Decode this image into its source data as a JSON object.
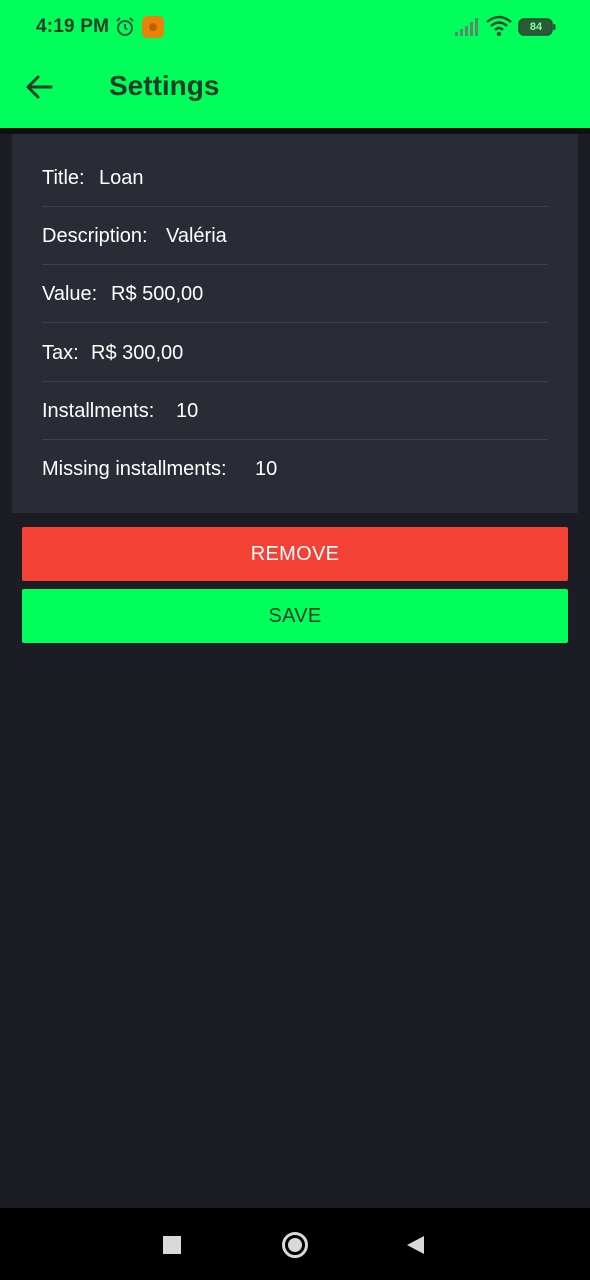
{
  "status_bar": {
    "time": "4:19 PM",
    "battery": "84",
    "icons": [
      "alarm-icon",
      "notification-app-icon",
      "signal-icon",
      "wifi-icon",
      "battery-icon"
    ]
  },
  "app_bar": {
    "title": "Settings",
    "back_icon": "arrow-left-icon"
  },
  "fields": [
    {
      "label": "Title:",
      "value": "Loan"
    },
    {
      "label": "Description:",
      "value": "Valéria"
    },
    {
      "label": "Value:",
      "value": "R$ 500,00"
    },
    {
      "label": "Tax:",
      "value": "R$ 300,00"
    },
    {
      "label": "Installments:",
      "value": "10"
    },
    {
      "label": "Missing installments:",
      "value": "10"
    }
  ],
  "actions": {
    "remove_label": "REMOVE",
    "save_label": "SAVE"
  },
  "nav_bar": {
    "icons": [
      "recents-square-icon",
      "home-circle-icon",
      "back-triangle-icon"
    ]
  },
  "colors": {
    "accent_green": "#00ff5a",
    "remove_red": "#f34235",
    "background": "#1b1c24",
    "card": "#292b35"
  }
}
